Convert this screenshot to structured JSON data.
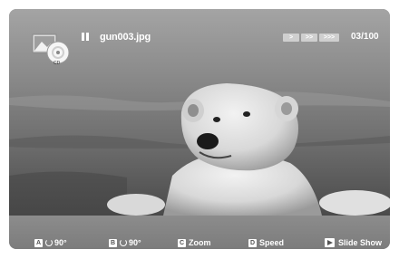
{
  "header": {
    "file_name": "gun003.jpg",
    "counter": "03/100",
    "speed_buttons": [
      ">",
      ">>",
      ">>>"
    ],
    "status_icon": "pause-icon",
    "media_icon": "photo-disc-icon"
  },
  "footer": {
    "hints": [
      {
        "key": "A",
        "label": "90°"
      },
      {
        "key": "B",
        "label": "90°"
      },
      {
        "key": "C",
        "label": "Zoom"
      },
      {
        "key": "D",
        "label": "Speed"
      },
      {
        "key": "",
        "label": "Slide Show"
      }
    ]
  }
}
